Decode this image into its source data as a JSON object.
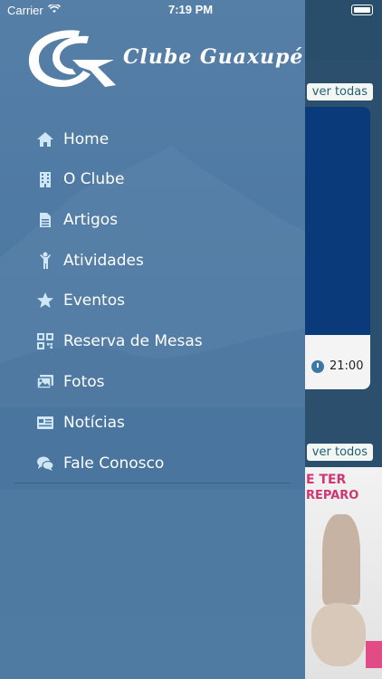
{
  "status_bar": {
    "carrier": "Carrier",
    "time": "7:19 PM"
  },
  "brand": {
    "name": "Clube Guaxupé"
  },
  "menu": [
    {
      "label": "Home",
      "icon": "home-icon"
    },
    {
      "label": "O Clube",
      "icon": "building-icon"
    },
    {
      "label": "Artigos",
      "icon": "document-icon"
    },
    {
      "label": "Atividades",
      "icon": "person-icon"
    },
    {
      "label": "Eventos",
      "icon": "star-icon"
    },
    {
      "label": "Reserva de Mesas",
      "icon": "qrcode-icon"
    },
    {
      "label": "Fotos",
      "icon": "images-icon"
    },
    {
      "label": "Notícias",
      "icon": "newspaper-icon"
    },
    {
      "label": "Fale Conosco",
      "icon": "chat-icon"
    }
  ],
  "background_app": {
    "see_all_1": "ver todas",
    "see_all_2": "ver todos",
    "event_time": "21:00",
    "promo_text_1": "E TER",
    "promo_text_2": "REPARO"
  },
  "colors": {
    "drawer": "#4f7aa3",
    "icon": "#cfe6f6",
    "accent": "#d03672"
  }
}
